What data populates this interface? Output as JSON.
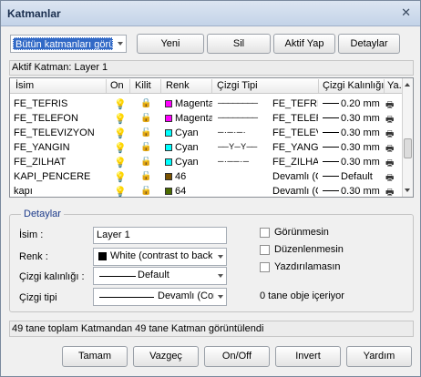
{
  "window": {
    "title": "Katmanlar",
    "close_glyph": "✕"
  },
  "toolbar": {
    "filter_value": "Bütün katmanları görü",
    "new_label": "Yeni",
    "delete_label": "Sil",
    "make_active_label": "Aktif Yap",
    "details_label": "Detaylar"
  },
  "active_layer": {
    "text": "Aktif Katman:  Layer 1"
  },
  "grid": {
    "columns": [
      "İsim",
      "On",
      "Kilit",
      "Renk",
      "Çizgi Tipi",
      "Çizgi Kalınlığı",
      "Ya..."
    ],
    "rows": [
      {
        "name": "FE_TEFRIS",
        "color_name": "Magenta",
        "color": "#ff00ff",
        "linetype_pattern": "────────",
        "linetype": "FE_TEFRIS",
        "weight": "0.20 mm",
        "lock": "locked"
      },
      {
        "name": "FE_TELEFON",
        "color_name": "Magenta",
        "color": "#ff00ff",
        "linetype_pattern": "────────",
        "linetype": "FE_TELEFO",
        "weight": "0.30 mm",
        "lock": "unlocked"
      },
      {
        "name": "FE_TELEVIZYON",
        "color_name": "Cyan",
        "color": "#00ffff",
        "linetype_pattern": "─ · ─ · ─ ·",
        "linetype": "FE_TELEVI",
        "weight": "0.30 mm",
        "lock": "unlocked"
      },
      {
        "name": "FE_YANGIN",
        "color_name": "Cyan",
        "color": "#00ffff",
        "linetype_pattern": "── Y ─ Y ──",
        "linetype": "FE_YANGIN",
        "weight": "0.30 mm",
        "lock": "unlocked"
      },
      {
        "name": "FE_ZILHAT",
        "color_name": "Cyan",
        "color": "#00ffff",
        "linetype_pattern": "─ · ─ ─ · ─",
        "linetype": "FE_ZILHAT",
        "weight": "0.30 mm",
        "lock": "unlocked"
      },
      {
        "name": "KAPI_PENCERE",
        "color_name": "46",
        "color": "#7a5200",
        "linetype_pattern": "",
        "linetype": "Devamlı (Co",
        "weight": "Default",
        "lock": "unlocked"
      },
      {
        "name": "kapı",
        "color_name": "64",
        "color": "#4b6b00",
        "linetype_pattern": "",
        "linetype": "Devamlı (Co",
        "weight": "0.30 mm",
        "lock": "unlocked"
      }
    ]
  },
  "details": {
    "group_title": "Detaylar",
    "name_label": "İsim :",
    "name_value": "Layer 1",
    "color_label": "Renk :",
    "color_value": "White (contrast to back",
    "weight_label": "Çizgi kalınlığı :",
    "weight_value": "Default",
    "linetype_label": "Çizgi tipi",
    "linetype_value": "Devamlı (Cor",
    "hidden_label": "Görünmesin",
    "noedit_label": "Düzenlenmesin",
    "noprint_label": "Yazdırılamasın",
    "object_count": "0 tane obje içeriyor"
  },
  "status": {
    "text": "49 tane toplam Katmandan 49 tane Katman görüntülendi"
  },
  "buttons": {
    "ok": "Tamam",
    "cancel": "Vazgeç",
    "onoff": "On/Off",
    "invert": "Invert",
    "help": "Yardım"
  }
}
